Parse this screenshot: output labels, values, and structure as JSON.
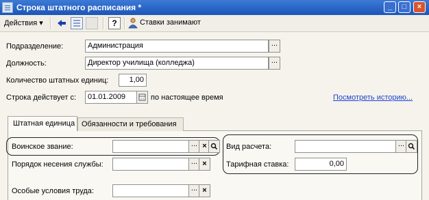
{
  "window": {
    "title": "Строка штатного расписания *",
    "controls": [
      "_",
      "□",
      "×"
    ]
  },
  "toolbar": {
    "actions_menu": "Действия ▾",
    "icons": [
      "back-arrow-icon",
      "list-icon",
      "copy-icon",
      "help-icon",
      "person-icon"
    ],
    "help_glyph": "?",
    "rates_button": "Ставки занимают"
  },
  "form": {
    "department": {
      "label": "Подразделение:",
      "value": "Администрация",
      "button": "..."
    },
    "position": {
      "label": "Должность:",
      "value": "Директор училища (колледжа)",
      "button": "..."
    },
    "staff_units": {
      "label": "Количество штатных единиц:",
      "value": "1,00"
    },
    "valid_from": {
      "label": "Строка действует с:",
      "value": "01.01.2009",
      "suffix": "по настоящее время"
    },
    "history_link": "Посмотреть историю..."
  },
  "tabs": [
    {
      "label": "Штатная единица",
      "active": true
    },
    {
      "label": "Обязанности и требования",
      "active": false
    }
  ],
  "staff_unit": {
    "military_rank": {
      "label": "Воинское звание:",
      "value": "",
      "buttons": [
        "...",
        "×",
        "🔍"
      ]
    },
    "service_order": {
      "label": "Порядок несения службы:",
      "value": "",
      "buttons": [
        "...",
        "×"
      ]
    },
    "work_conditions": {
      "label": "Особые условия труда:",
      "value": "",
      "buttons": [
        "...",
        "×"
      ]
    },
    "calc_type": {
      "label": "Вид расчета:",
      "value": "",
      "buttons": [
        "...",
        "🔍"
      ]
    },
    "tariff_rate": {
      "label": "Тарифная ставка:",
      "value": "0,00"
    }
  },
  "colors": {
    "titlebar": "#1c55b8",
    "link": "#1d3fd3",
    "close": "#d9542c",
    "window_bg": "#f5f3ec"
  }
}
